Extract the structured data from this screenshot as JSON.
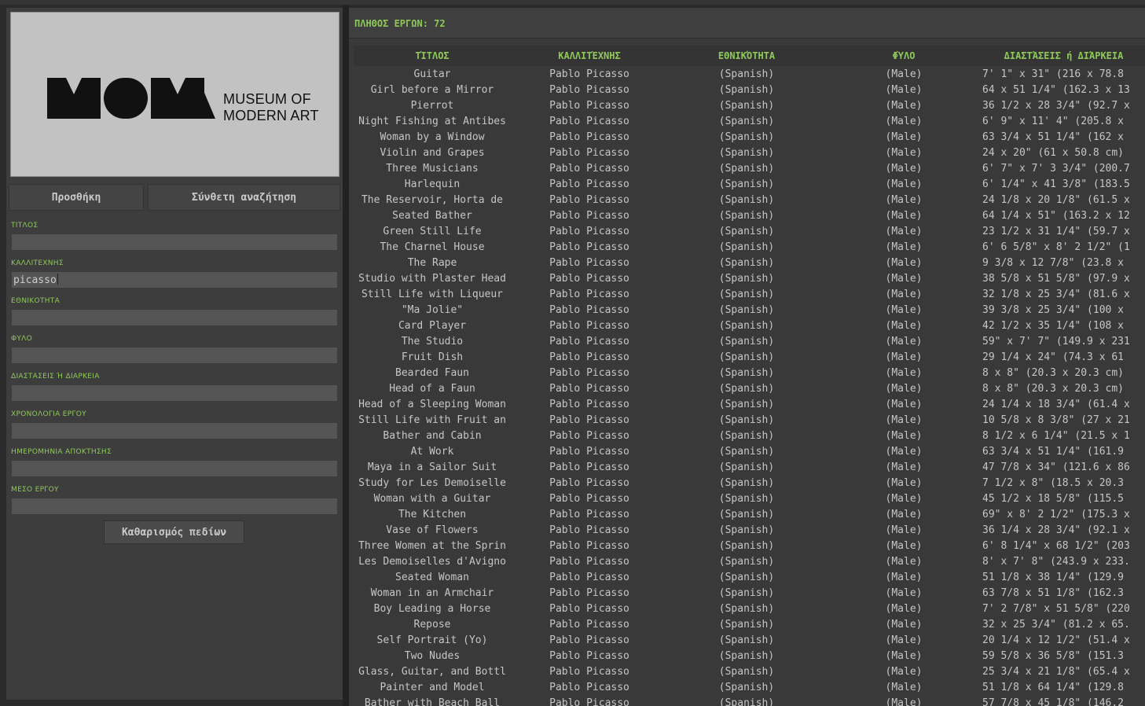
{
  "form": {
    "add_button": "Προσθήκη",
    "advanced_search_button": "Σύνθετη αναζήτηση",
    "clear_button": "Καθαρισμός πεδίων",
    "fields": [
      {
        "label": "ΤΙΤΛΟΣ",
        "value": ""
      },
      {
        "label": "ΚΑΛΛΙΤΕΧΝΗΣ",
        "value": "picasso"
      },
      {
        "label": "ΕΘΝΙΚΟΤΗΤΑ",
        "value": ""
      },
      {
        "label": "ΦΥΛΟ",
        "value": ""
      },
      {
        "label": "ΔΙΑΣΤΑΣΕΙΣ Ή ΔΙΑΡΚΕΙΑ",
        "value": ""
      },
      {
        "label": "ΧΡΟΝΟΛΟΓΙΑ ΕΡΓΟΥ",
        "value": ""
      },
      {
        "label": "ΗΜΕΡΟΜΗΝΙΑ ΑΠΟΚΤΗΣΗΣ",
        "value": ""
      },
      {
        "label": "ΜΕΣΟ ΕΡΓΟΥ",
        "value": ""
      }
    ]
  },
  "logo": {
    "line1": "MUSEUM OF",
    "line2": "MODERN ART",
    "wordmark": "MoMA"
  },
  "results": {
    "count_label": "ΠΛΗΘΟΣ ΕΡΓΩΝ: 72",
    "columns": [
      "ΤΊΤΛΟΣ",
      "ΚΑΛΛΙΤΈΧΝΗΣ",
      "ΕΘΝΙΚΌΤΗΤΑ",
      "ΦΎΛΟ",
      "ΔΙΑΣΤΆΣΕΙΣ ή ΔΙΆΡΚΕΙΑ"
    ],
    "rows": [
      [
        "Guitar",
        "Pablo Picasso",
        "(Spanish)",
        "(Male)",
        "7' 1\" x 31\" (216 x 78.8"
      ],
      [
        "Girl before a Mirror",
        "Pablo Picasso",
        "(Spanish)",
        "(Male)",
        "64 x 51 1/4\" (162.3 x 13"
      ],
      [
        "Pierrot",
        "Pablo Picasso",
        "(Spanish)",
        "(Male)",
        "36 1/2 x 28 3/4\" (92.7 x"
      ],
      [
        "Night Fishing at Antibes",
        "Pablo Picasso",
        "(Spanish)",
        "(Male)",
        "6' 9\" x 11' 4\" (205.8 x"
      ],
      [
        "Woman by a Window",
        "Pablo Picasso",
        "(Spanish)",
        "(Male)",
        "63 3/4 x 51 1/4\" (162 x"
      ],
      [
        "Violin and Grapes",
        "Pablo Picasso",
        "(Spanish)",
        "(Male)",
        " 24 x 20\" (61 x 50.8 cm)"
      ],
      [
        "Three Musicians",
        "Pablo Picasso",
        "(Spanish)",
        "(Male)",
        "6' 7\" x 7' 3 3/4\" (200.7"
      ],
      [
        "Harlequin",
        "Pablo Picasso",
        "(Spanish)",
        "(Male)",
        "6' 1/4\" x 41 3/8\" (183.5"
      ],
      [
        "The Reservoir, Horta de",
        "Pablo Picasso",
        "(Spanish)",
        "(Male)",
        "24 1/8 x 20 1/8\" (61.5 x"
      ],
      [
        "Seated Bather",
        "Pablo Picasso",
        "(Spanish)",
        "(Male)",
        "64 1/4 x 51\" (163.2 x 12"
      ],
      [
        "Green Still Life",
        "Pablo Picasso",
        "(Spanish)",
        "(Male)",
        "23 1/2 x 31 1/4\" (59.7 x"
      ],
      [
        "The Charnel House",
        "Pablo Picasso",
        "(Spanish)",
        "(Male)",
        "6' 6 5/8\" x 8' 2 1/2\" (1"
      ],
      [
        "The Rape",
        "Pablo Picasso",
        "(Spanish)",
        "(Male)",
        "9 3/8 x 12 7/8\" (23.8 x"
      ],
      [
        "Studio with Plaster Head",
        "Pablo Picasso",
        "(Spanish)",
        "(Male)",
        "38 5/8 x 51 5/8\" (97.9 x"
      ],
      [
        "Still Life with Liqueur",
        "Pablo Picasso",
        "(Spanish)",
        "(Male)",
        "32 1/8 x 25 3/4\" (81.6 x"
      ],
      [
        "\"Ma Jolie\"",
        "Pablo Picasso",
        "(Spanish)",
        "(Male)",
        "39 3/8 x 25 3/4\" (100 x"
      ],
      [
        "Card Player",
        "Pablo Picasso",
        "(Spanish)",
        "(Male)",
        "42 1/2 x 35 1/4\" (108 x"
      ],
      [
        "The Studio",
        "Pablo Picasso",
        "(Spanish)",
        "(Male)",
        "59\" x 7' 7\" (149.9 x 231"
      ],
      [
        "Fruit Dish",
        "Pablo Picasso",
        "(Spanish)",
        "(Male)",
        "29 1/4 x 24\" (74.3 x 61"
      ],
      [
        "Bearded Faun",
        "Pablo Picasso",
        "(Spanish)",
        "(Male)",
        " 8 x 8\" (20.3 x 20.3 cm)"
      ],
      [
        "Head of a Faun",
        "Pablo Picasso",
        "(Spanish)",
        "(Male)",
        " 8 x 8\" (20.3 x 20.3 cm)"
      ],
      [
        "Head of a Sleeping Woman",
        "Pablo Picasso",
        "(Spanish)",
        "(Male)",
        "24 1/4 x 18 3/4\" (61.4 x"
      ],
      [
        "Still Life with Fruit an",
        "Pablo Picasso",
        "(Spanish)",
        "(Male)",
        "10 5/8 x 8 3/8\" (27 x 21"
      ],
      [
        "Bather and Cabin",
        "Pablo Picasso",
        "(Spanish)",
        "(Male)",
        "8 1/2 x 6 1/4\" (21.5 x 1"
      ],
      [
        "At Work",
        "Pablo Picasso",
        "(Spanish)",
        "(Male)",
        "63 3/4 x 51 1/4\" (161.9"
      ],
      [
        "Maya in a Sailor Suit",
        "Pablo Picasso",
        "(Spanish)",
        "(Male)",
        "47 7/8 x 34\" (121.6 x 86"
      ],
      [
        "Study for Les Demoiselle",
        "Pablo Picasso",
        "(Spanish)",
        "(Male)",
        "7 1/2 x 8\" (18.5 x 20.3"
      ],
      [
        "Woman with a Guitar",
        "Pablo Picasso",
        "(Spanish)",
        "(Male)",
        "45 1/2 x 18 5/8\" (115.5"
      ],
      [
        "The Kitchen",
        "Pablo Picasso",
        "(Spanish)",
        "(Male)",
        "69\" x 8' 2 1/2\" (175.3 x"
      ],
      [
        "Vase of Flowers",
        "Pablo Picasso",
        "(Spanish)",
        "(Male)",
        "36 1/4 x 28 3/4\" (92.1 x"
      ],
      [
        "Three Women at the Sprin",
        "Pablo Picasso",
        "(Spanish)",
        "(Male)",
        "6' 8 1/4\" x 68 1/2\" (203"
      ],
      [
        "Les Demoiselles d'Avigno",
        "Pablo Picasso",
        "(Spanish)",
        "(Male)",
        "8' x 7' 8\" (243.9 x 233."
      ],
      [
        "Seated Woman",
        "Pablo Picasso",
        "(Spanish)",
        "(Male)",
        "51 1/8 x 38 1/4\" (129.9"
      ],
      [
        "Woman in an Armchair",
        "Pablo Picasso",
        "(Spanish)",
        "(Male)",
        "63 7/8 x 51 1/8\" (162.3"
      ],
      [
        "Boy Leading a Horse",
        "Pablo Picasso",
        "(Spanish)",
        "(Male)",
        "7' 2 7/8\" x 51 5/8\" (220"
      ],
      [
        "Repose",
        "Pablo Picasso",
        "(Spanish)",
        "(Male)",
        "32 x 25 3/4\" (81.2 x 65."
      ],
      [
        "Self Portrait (Yo)",
        "Pablo Picasso",
        "(Spanish)",
        "(Male)",
        "20 1/4 x 12 1/2\" (51.4 x"
      ],
      [
        "Two Nudes",
        "Pablo Picasso",
        "(Spanish)",
        "(Male)",
        "59 5/8 x 36 5/8\" (151.3"
      ],
      [
        "Glass, Guitar, and Bottl",
        "Pablo Picasso",
        "(Spanish)",
        "(Male)",
        "25 3/4 x 21 1/8\" (65.4 x"
      ],
      [
        "Painter and Model",
        "Pablo Picasso",
        "(Spanish)",
        "(Male)",
        "51 1/8 x 64 1/4\" (129.8"
      ],
      [
        "Bather with Beach Ball",
        "Pablo Picasso",
        "(Spanish)",
        "(Male)",
        "57 7/8 x 45 1/8\" (146.2"
      ]
    ]
  }
}
